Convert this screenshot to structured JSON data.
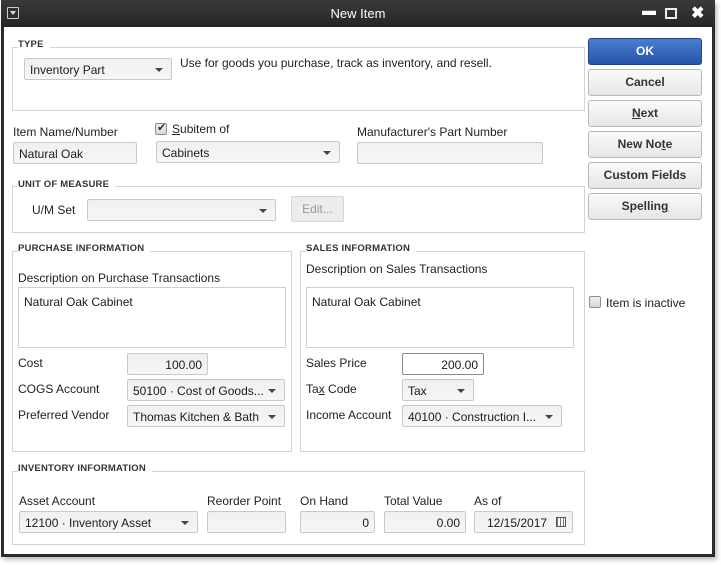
{
  "window": {
    "title": "New Item"
  },
  "type_section": {
    "label": "TYPE",
    "selected_type": "Inventory Part",
    "description": "Use for goods you purchase, track as inventory, and resell."
  },
  "item": {
    "name_label": "Item Name/Number",
    "name_value": "Natural Oak",
    "subitem_label": "Subitem of",
    "subitem_checked": true,
    "subitem_value": "Cabinets",
    "mfr_label": "Manufacturer's Part Number",
    "mfr_value": ""
  },
  "unit_of_measure": {
    "label": "UNIT OF MEASURE",
    "um_set_label": "U/M Set",
    "um_set_value": "",
    "edit_label": "Edit..."
  },
  "purchase": {
    "label": "PURCHASE INFORMATION",
    "desc_label": "Description on Purchase Transactions",
    "desc_value": "Natural Oak Cabinet",
    "cost_label": "Cost",
    "cost_value": "100.00",
    "cogs_label": "COGS Account",
    "cogs_value": "50100 · Cost of Goods...",
    "vendor_label": "Preferred Vendor",
    "vendor_value": "Thomas Kitchen & Bath"
  },
  "sales": {
    "label": "SALES INFORMATION",
    "desc_label": "Description on Sales Transactions",
    "desc_value": "Natural Oak Cabinet",
    "price_label": "Sales Price",
    "price_value": "200.00",
    "tax_label": "Tax Code",
    "tax_value": "Tax",
    "income_label": "Income Account",
    "income_value": "40100 · Construction I..."
  },
  "inventory": {
    "label": "INVENTORY INFORMATION",
    "asset_label": "Asset Account",
    "asset_value": "12100 · Inventory Asset",
    "reorder_label": "Reorder Point",
    "reorder_value": "",
    "onhand_label": "On Hand",
    "onhand_value": "0",
    "total_label": "Total Value",
    "total_value": "0.00",
    "asof_label": "As of",
    "asof_value": "12/15/2017"
  },
  "buttons": {
    "ok": "OK",
    "cancel": "Cancel",
    "next": "Next",
    "new_note": "New Note",
    "custom_fields": "Custom Fields",
    "spelling": "Spelling"
  },
  "inactive": {
    "label": "Item is inactive",
    "checked": false
  }
}
